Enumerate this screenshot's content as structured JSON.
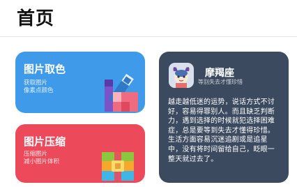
{
  "header": {
    "title": "首页"
  },
  "cards": {
    "color_picker": {
      "title": "图片取色",
      "subtitle_line1": "获取图片",
      "subtitle_line2": "像素点颜色",
      "icon": "color-palette-icon",
      "color": "#3f9bea"
    },
    "compress": {
      "title": "图片压缩",
      "subtitle_line1": "压缩图片",
      "subtitle_line2": "减小图片体积",
      "icon": "archive-zip-icon",
      "color": "#ec4a5b"
    }
  },
  "profile": {
    "name": "摩羯座",
    "motto": "等别失去才懂珍惜",
    "avatar_icon": "capricorn-avatar-icon",
    "card_color": "#3b4a5f",
    "quote": "越走越低迷的运势，说话方式不讨好，容易得罪别人。而且缺乏判断力，遇到选择的时候就犯选择困难症，总是要等到失去才懂得珍惜。生活方面容易沉迷追剧或是追星中，没有将时间留给自己，眨眼一整天就过去了。"
  }
}
